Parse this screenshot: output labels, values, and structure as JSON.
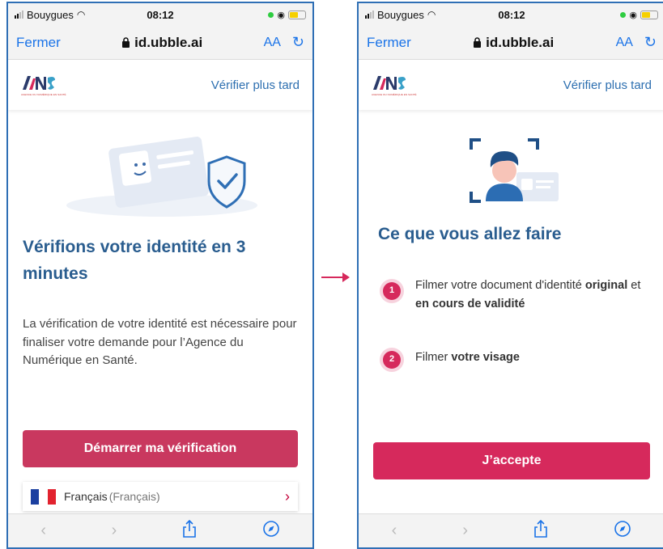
{
  "status": {
    "carrier": "Bouygues",
    "time": "08:12"
  },
  "browser": {
    "close_label": "Fermer",
    "url": "id.ubble.ai",
    "text_size_label": "AA"
  },
  "app": {
    "verify_later": "Vérifier plus tard",
    "logo_text": "ANS",
    "logo_tagline": "AGENCE DU NUMÉRIQUE EN SANTÉ"
  },
  "screen1": {
    "title": "Vérifions votre identité en 3 minutes",
    "body": "La vérification de votre identité est nécessaire pour finaliser votre demande pour l’Agence du Numérique en Santé.",
    "cta": "Démarrer ma vérification",
    "language": "Français",
    "language_native": "(Français)"
  },
  "screen2": {
    "title": "Ce que vous allez faire",
    "steps": [
      {
        "number": "1",
        "text_a": "Filmer votre document d'identité ",
        "bold_a": "original",
        "text_b": " et ",
        "bold_b": "en cours de validité"
      },
      {
        "number": "2",
        "text_a": "Filmer ",
        "bold_a": "votre visage"
      }
    ],
    "cta": "J’accepte"
  },
  "colors": {
    "primary_button_1": "#c9385f",
    "primary_button_2": "#d6295c",
    "title_blue": "#2a5d8f",
    "link_blue": "#1a73e8",
    "frame_blue": "#2f6fb5",
    "arrow": "#d6295c"
  },
  "icons": [
    "signal-icon",
    "wifi-icon",
    "lock-icon",
    "reload-icon",
    "back-icon",
    "forward-icon",
    "share-icon",
    "compass-icon",
    "chevron-right-icon"
  ]
}
